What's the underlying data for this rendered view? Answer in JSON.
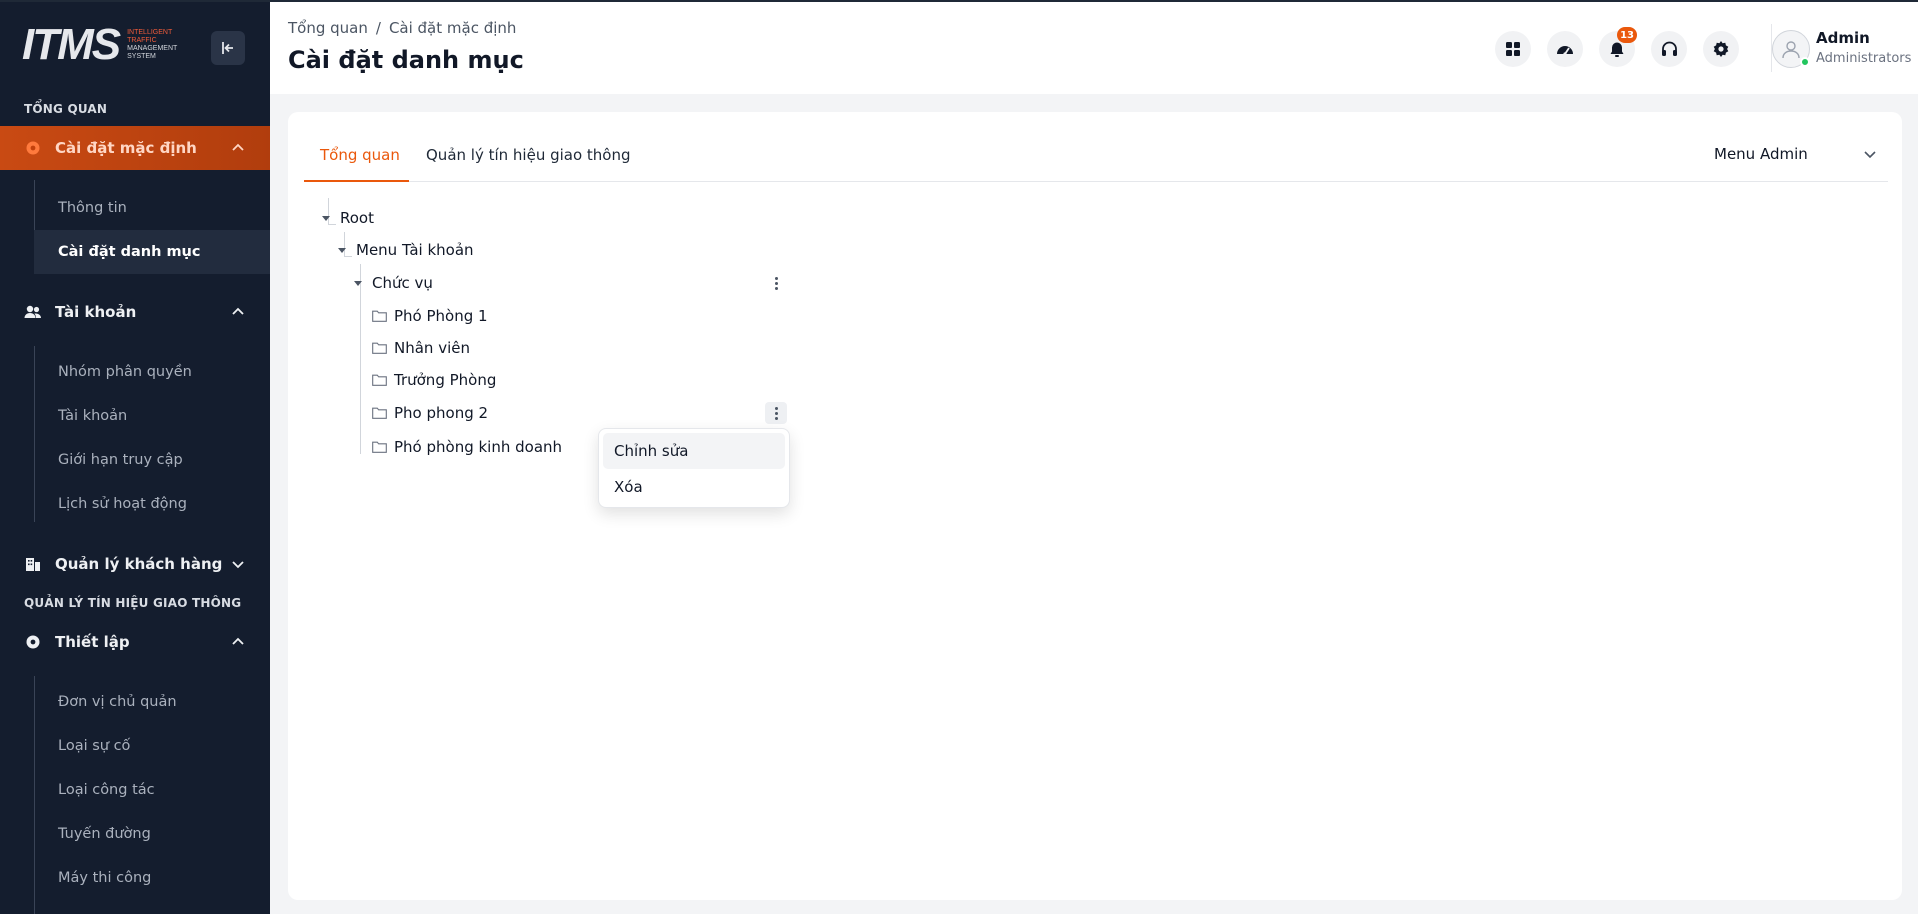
{
  "brand": {
    "logo_text": "ITMS",
    "logo_sub_red": "INTELLIGENT TRAFFIC",
    "logo_sub": "MANAGEMENT SYSTEM"
  },
  "sidebar": {
    "section_overview": "TỔNG QUAN",
    "section_traffic": "QUẢN LÝ TÍN HIỆU GIAO THÔNG",
    "groups": [
      {
        "label": "Cài đặt mặc định",
        "icon": "gear-icon",
        "items": [
          "Thông tin",
          "Cài đặt danh mục"
        ]
      },
      {
        "label": "Tài khoản",
        "icon": "users-icon",
        "items": [
          "Nhóm phân quyền",
          "Tài khoản",
          "Giới hạn truy cập",
          "Lịch sử hoạt động"
        ]
      },
      {
        "label": "Quản lý khách hàng",
        "icon": "building-icon",
        "items": []
      },
      {
        "label": "Thiết lập",
        "icon": "gear-icon",
        "items": [
          "Đơn vị chủ quản",
          "Loại sự cố",
          "Loại công tác",
          "Tuyến đường",
          "Máy thi công"
        ]
      }
    ]
  },
  "header": {
    "breadcrumb": [
      "Tổng quan",
      "/",
      "Cài đặt mặc định"
    ],
    "title": "Cài đặt danh mục",
    "notification_count": "13",
    "user_name": "Admin",
    "user_role": "Administrators"
  },
  "tabs": [
    "Tổng quan",
    "Quản lý tín hiệu giao thông"
  ],
  "menu_select": {
    "value": "Menu Admin"
  },
  "tree": {
    "root": "Root",
    "menu": "Menu Tài khoản",
    "group": "Chức vụ",
    "leaves": [
      "Phó Phòng 1",
      "Nhân viên",
      "Trưởng Phòng",
      "Pho phong 2",
      "Phó phòng kinh doanh"
    ]
  },
  "context_menu": [
    "Chỉnh sửa",
    "Xóa"
  ],
  "colors": {
    "accent": "#ea580c",
    "sidebar_bg": "#141d2e"
  }
}
